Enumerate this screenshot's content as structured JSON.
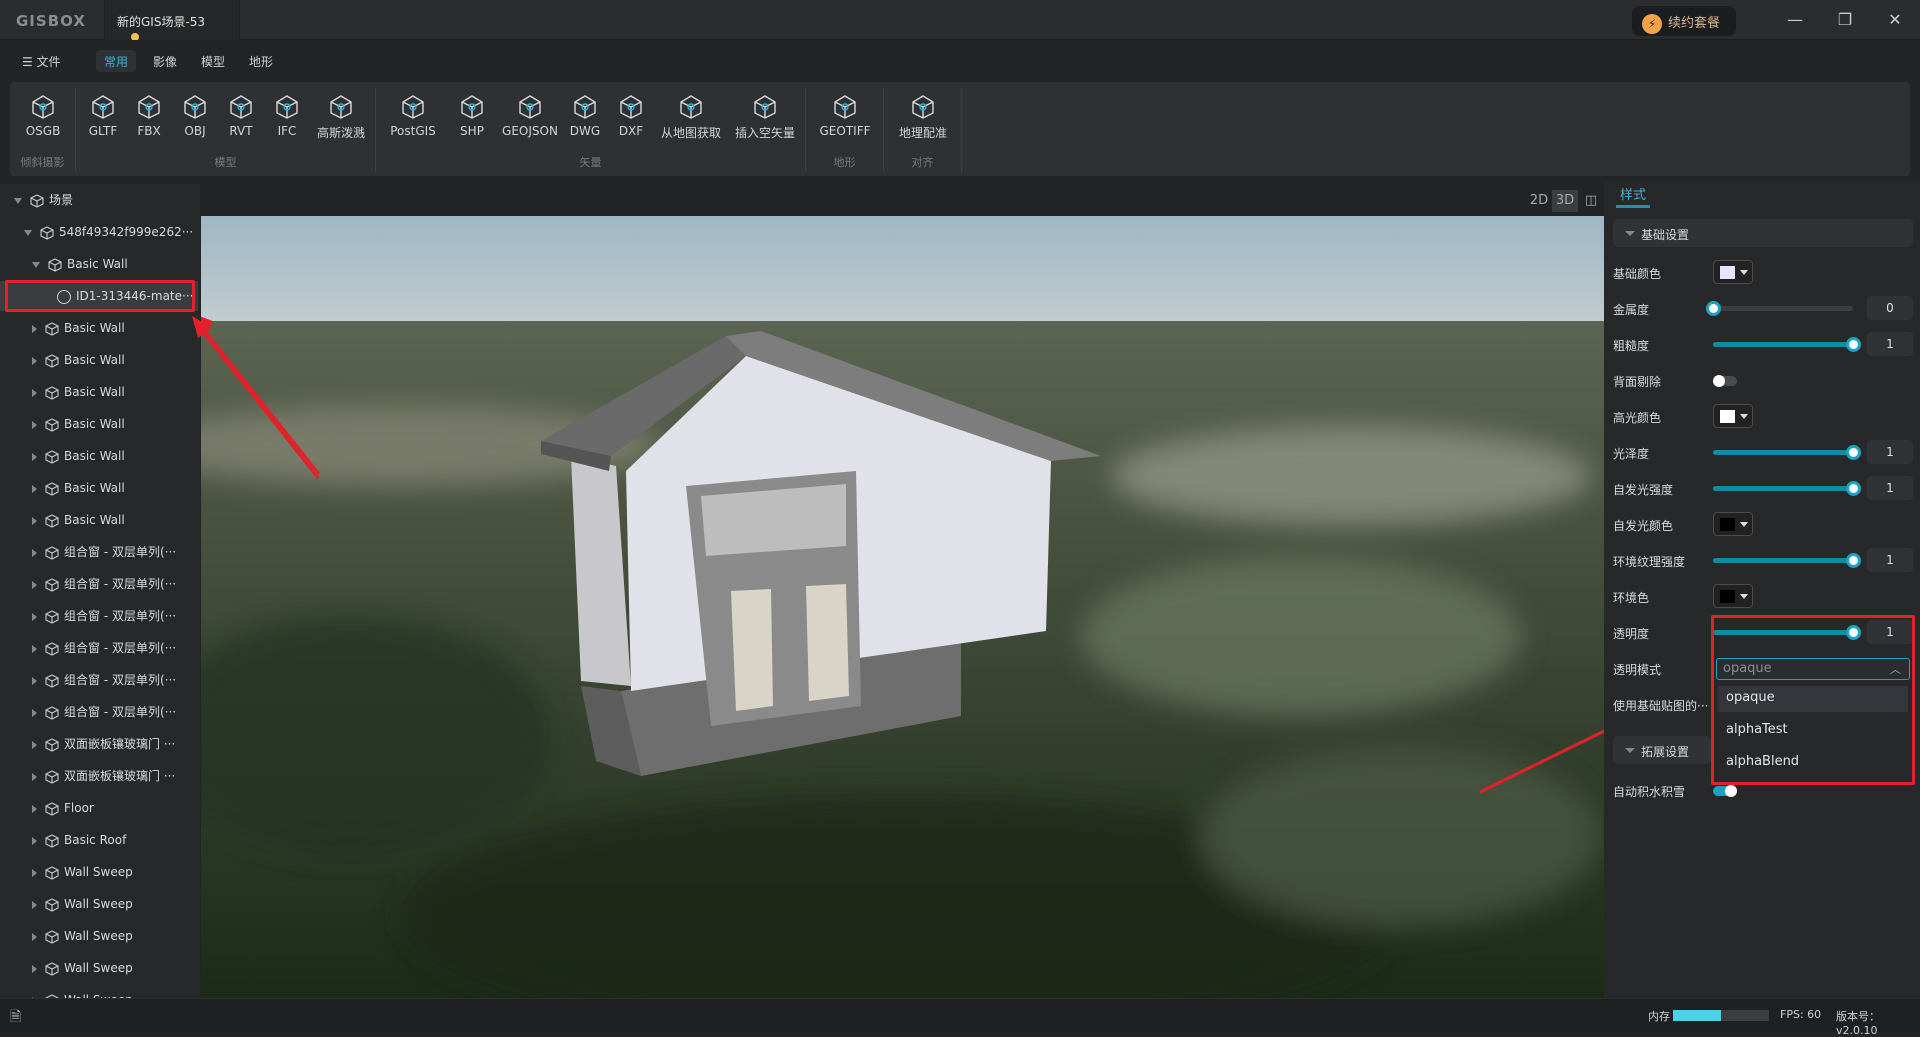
{
  "app": {
    "logo": "GISBOX",
    "doc_tab": "新的GIS场景-53",
    "renew": "续约套餐",
    "accent": "#1aa3c4"
  },
  "menu": {
    "file": "文件",
    "tabs": [
      "常用",
      "影像",
      "模型",
      "地形"
    ],
    "active": 0
  },
  "ribbon": {
    "groups": [
      {
        "label": "倾斜摄影",
        "items": [
          {
            "label": "OSGB",
            "icon": "osgb-icon"
          }
        ]
      },
      {
        "label": "模型",
        "items": [
          {
            "label": "GLTF",
            "icon": "cube-icon"
          },
          {
            "label": "FBX",
            "icon": "cube-icon"
          },
          {
            "label": "OBJ",
            "icon": "cube-icon"
          },
          {
            "label": "RVT",
            "icon": "cube-icon"
          },
          {
            "label": "IFC",
            "icon": "cube-icon"
          },
          {
            "label": "高斯泼溅",
            "icon": "splat-icon"
          }
        ]
      },
      {
        "label": "矢量",
        "items": [
          {
            "label": "PostGIS",
            "icon": "database-icon"
          },
          {
            "label": "SHP",
            "icon": "file-chart-icon"
          },
          {
            "label": "GEOJSON",
            "icon": "code-map-icon"
          },
          {
            "label": "DWG",
            "icon": "dwg-icon"
          },
          {
            "label": "DXF",
            "icon": "dxf-icon"
          },
          {
            "label": "从地图获取",
            "icon": "map-pin-icon"
          },
          {
            "label": "插入空矢量",
            "icon": "empty-vector-icon"
          }
        ]
      },
      {
        "label": "地形",
        "items": [
          {
            "label": "GEOTIFF",
            "icon": "terrain-icon"
          }
        ]
      },
      {
        "label": "对齐",
        "items": [
          {
            "label": "地理配准",
            "icon": "georef-icon"
          }
        ]
      }
    ]
  },
  "tree": {
    "root": "场景",
    "model": "548f49342f999e262···",
    "items": [
      {
        "label": "Basic Wall",
        "open": true
      },
      {
        "label": "ID1-313446-mate···",
        "child": true,
        "selected": true
      },
      {
        "label": "Basic Wall"
      },
      {
        "label": "Basic Wall"
      },
      {
        "label": "Basic Wall"
      },
      {
        "label": "Basic Wall"
      },
      {
        "label": "Basic Wall"
      },
      {
        "label": "Basic Wall"
      },
      {
        "label": "Basic Wall"
      },
      {
        "label": "组合窗 - 双层单列(···"
      },
      {
        "label": "组合窗 - 双层单列(···"
      },
      {
        "label": "组合窗 - 双层单列(···"
      },
      {
        "label": "组合窗 - 双层单列(···"
      },
      {
        "label": "组合窗 - 双层单列(···"
      },
      {
        "label": "组合窗 - 双层单列(···"
      },
      {
        "label": "双面嵌板镶玻璃门 ···"
      },
      {
        "label": "双面嵌板镶玻璃门 ···"
      },
      {
        "label": "Floor"
      },
      {
        "label": "Basic Roof"
      },
      {
        "label": "Wall Sweep"
      },
      {
        "label": "Wall Sweep"
      },
      {
        "label": "Wall Sweep"
      },
      {
        "label": "Wall Sweep"
      },
      {
        "label": "Wall Sweep"
      }
    ]
  },
  "view": {
    "modes": [
      "2D",
      "3D"
    ],
    "active": "3D"
  },
  "panel": {
    "tab": "样式",
    "basic": "基础设置",
    "extended": "拓展设置",
    "rows": [
      {
        "label": "基础颜色",
        "type": "color",
        "color": "#e6e4fa"
      },
      {
        "label": "金属度",
        "type": "slider",
        "value": 0
      },
      {
        "label": "粗糙度",
        "type": "slider",
        "value": 1
      },
      {
        "label": "背面剔除",
        "type": "toggle",
        "on": false
      },
      {
        "label": "高光颜色",
        "type": "color",
        "color": "#ffffff"
      },
      {
        "label": "光泽度",
        "type": "slider",
        "value": 1
      },
      {
        "label": "自发光强度",
        "type": "slider",
        "value": 1
      },
      {
        "label": "自发光颜色",
        "type": "color",
        "color": "#000000"
      },
      {
        "label": "环境纹理强度",
        "type": "slider",
        "value": 1
      },
      {
        "label": "环境色",
        "type": "color",
        "color": "#000000"
      },
      {
        "label": "透明度",
        "type": "slider",
        "value": 1
      },
      {
        "label": "透明模式",
        "type": "select"
      },
      {
        "label": "使用基础贴图的···",
        "type": "none"
      }
    ],
    "transparency_mode": {
      "value": "opaque",
      "options": [
        "opaque",
        "alphaTest",
        "alphaBlend"
      ]
    },
    "auto_snow": {
      "label": "自动积水积雪",
      "on": true
    }
  },
  "status": {
    "memory_label": "内存",
    "memory_fraction": 0.5,
    "fps": "FPS: 60",
    "version": "版本号：v2.0.10"
  }
}
